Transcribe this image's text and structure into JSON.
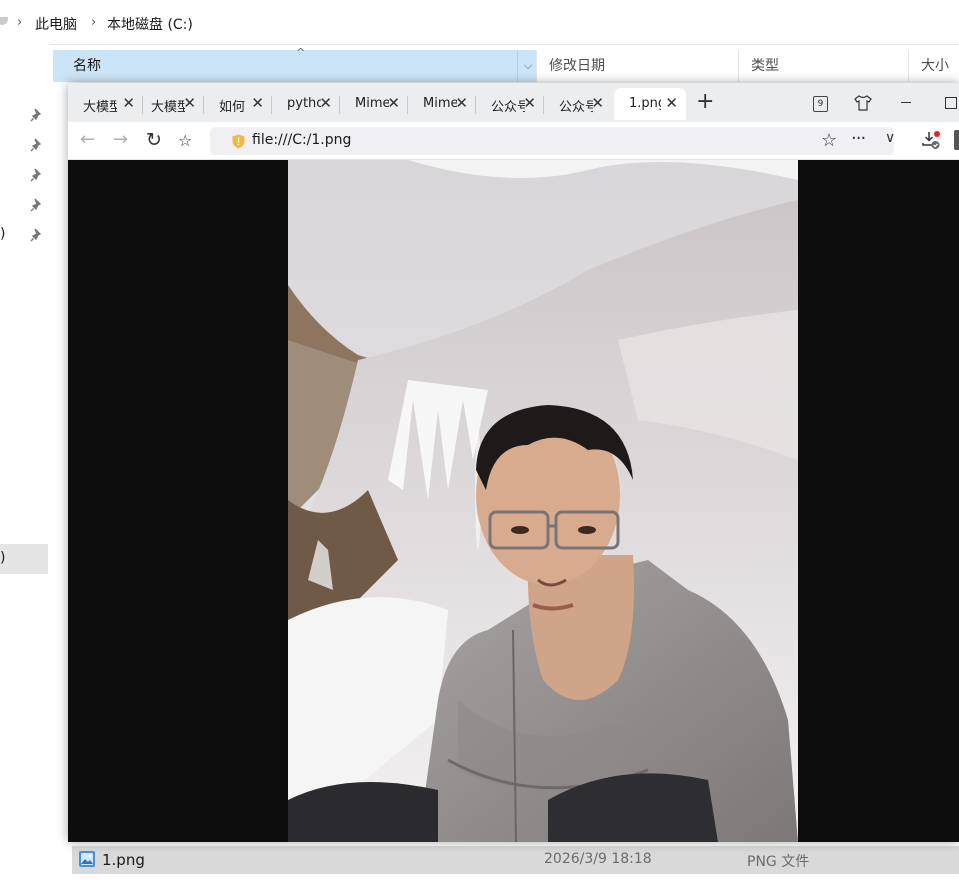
{
  "explorer": {
    "breadcrumb": [
      "此电脑",
      "本地磁盘 (C:)"
    ],
    "columns": {
      "name": "名称",
      "date": "修改日期",
      "type": "类型",
      "size": "大小"
    },
    "nav_paren_1": ")",
    "nav_paren_2": ")",
    "file_row": {
      "name": "1.png",
      "date": "2026/3/9 18:18",
      "type": "PNG 文件"
    }
  },
  "browser": {
    "tabs": [
      {
        "title": "大模型"
      },
      {
        "title": "大模型"
      },
      {
        "title": "如何"
      },
      {
        "title": "python"
      },
      {
        "title": "Mime"
      },
      {
        "title": "Mime"
      },
      {
        "title": "公众号"
      },
      {
        "title": "公众号"
      },
      {
        "title": "1.png",
        "active": true
      }
    ],
    "tab_close": "✕",
    "new_tab": "+",
    "tab_count": "9",
    "url": "file:///C:/1.png"
  },
  "icons": {
    "pin": "pin-icon",
    "back": "back-arrow-icon",
    "forward": "forward-arrow-icon",
    "reload": "reload-icon",
    "star": "star-icon",
    "download": "download-icon"
  },
  "colors": {
    "selected_header": "#cce4f7",
    "row_highlight": "#d9d9d9",
    "tab_bar": "#ecedef",
    "viewer_background": "#0d0d0d"
  }
}
